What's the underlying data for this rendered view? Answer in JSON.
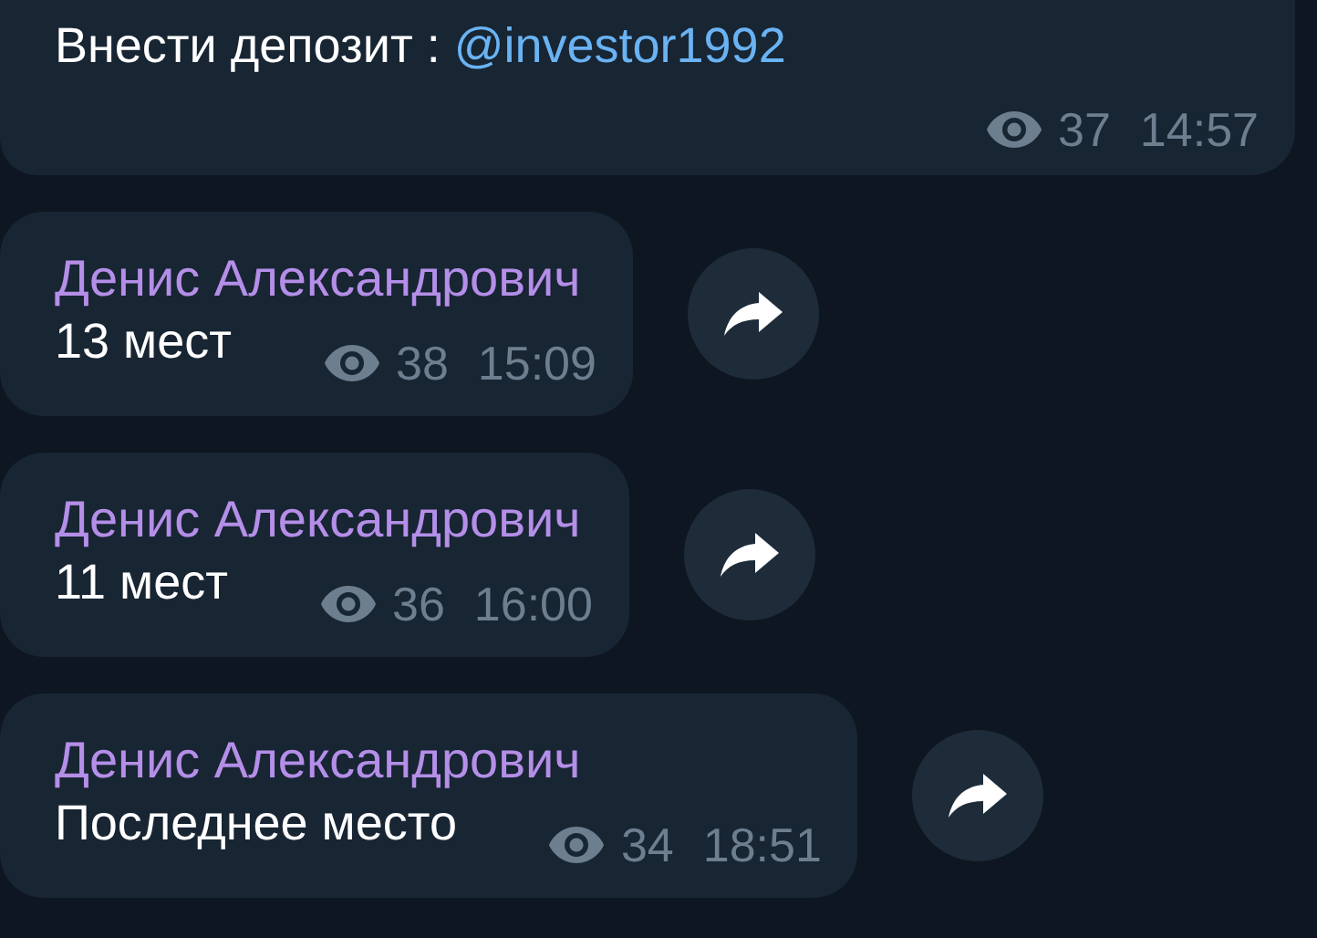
{
  "messages": [
    {
      "text": "Внести депозит : ",
      "link": "@investor1992",
      "views": "37",
      "time": "14:57",
      "share_button": false
    },
    {
      "author": "Денис Александрович",
      "text": "13 мест",
      "views": "38",
      "time": "15:09",
      "share_button": true
    },
    {
      "author": "Денис Александрович",
      "text": "11 мест",
      "views": "36",
      "time": "16:00",
      "share_button": true
    },
    {
      "author": "Денис Александрович",
      "text": "Последнее место",
      "views": "34",
      "time": "18:51",
      "share_button": true
    }
  ]
}
